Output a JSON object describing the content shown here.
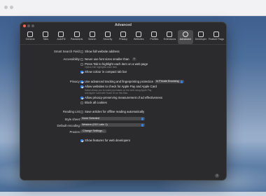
{
  "window": {
    "title": "Advanced"
  },
  "toolbar": {
    "items": [
      {
        "label": "General",
        "icon": "gear-icon",
        "active": false
      },
      {
        "label": "Tabs",
        "icon": "tabs-icon",
        "active": false
      },
      {
        "label": "AutoFill",
        "icon": "autofill-icon",
        "active": false
      },
      {
        "label": "Passwords",
        "icon": "key-icon",
        "active": false
      },
      {
        "label": "Search",
        "icon": "search-icon",
        "active": false
      },
      {
        "label": "Security",
        "icon": "lock-icon",
        "active": false
      },
      {
        "label": "Privacy",
        "icon": "hand-icon",
        "active": false
      },
      {
        "label": "Websites",
        "icon": "globe-icon",
        "active": false
      },
      {
        "label": "Profiles",
        "icon": "person-icon",
        "active": false
      },
      {
        "label": "Extensions",
        "icon": "puzzle-icon",
        "active": false
      },
      {
        "label": "Advanced",
        "icon": "gears-icon",
        "active": true
      },
      {
        "label": "Developer",
        "icon": "hammer-icon",
        "active": false
      },
      {
        "label": "Feature Flags",
        "icon": "flag-icon",
        "active": false
      }
    ]
  },
  "smart_search": {
    "label": "Smart Search Field:",
    "option": "Show full website address"
  },
  "accessibility": {
    "label": "Accessibility:",
    "font_option": "Never use font sizes smaller than",
    "font_value": "9",
    "tab_option": "Press Tab to highlight each item on a web page",
    "tab_desc": "Option-Tab highlights each item.",
    "colour_option": "Show colour in compact tab bar"
  },
  "privacy": {
    "label": "Privacy:",
    "tracking_option": "Use advanced tracking and fingerprinting protection",
    "tracking_value": "in Private Browsing",
    "apple_pay_option": "Allow websites to check for Apple Pay and Apple Card",
    "apple_pay_desc": "Safari allows you to make purchases on the web using Apple Pay and Apple Card with Touch ID on this Mac.",
    "ad_option": "Allow privacy-preserving measurement of ad effectiveness",
    "cookies_option": "Block all cookies"
  },
  "reading_list": {
    "label": "Reading List:",
    "option": "Save articles for offline reading automatically"
  },
  "style_sheet": {
    "label": "Style sheet:",
    "value": "None Selected"
  },
  "encoding": {
    "label": "Default encoding:",
    "value": "Western (ISO Latin 1)"
  },
  "proxies": {
    "label": "Proxies:",
    "button": "Change Settings..."
  },
  "developer": {
    "option": "Show features for web developers"
  },
  "help": {
    "label": "?"
  },
  "colors": {
    "accent": "#2f7ff5",
    "dialog_bg": "#2b2b2d"
  }
}
